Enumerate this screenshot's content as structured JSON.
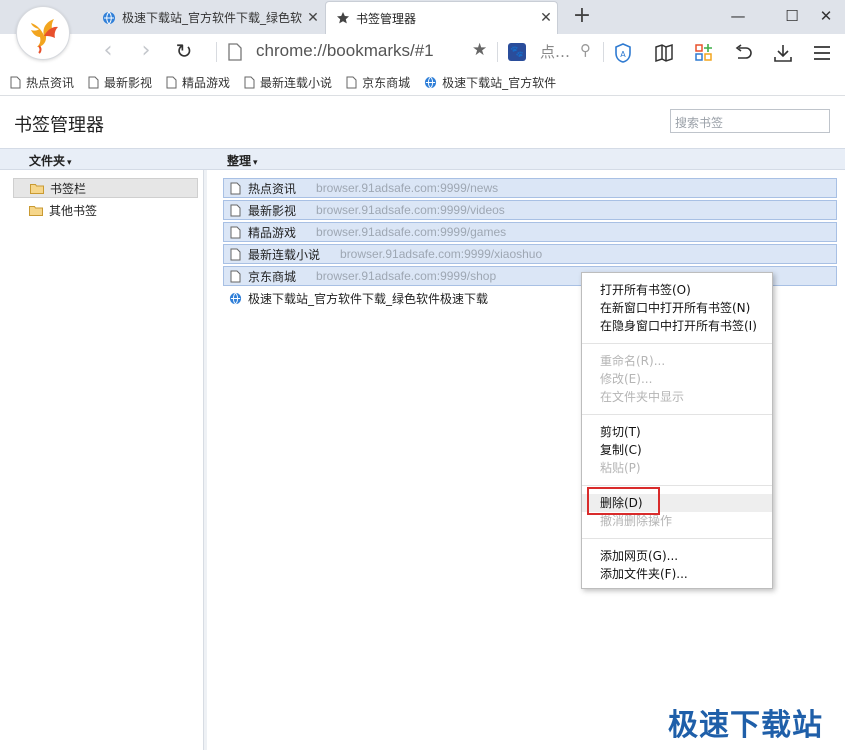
{
  "tabs": [
    {
      "label": "极速下载站_官方软件下载_绿色软件",
      "close": "✕"
    },
    {
      "label": "书签管理器",
      "close": "✕"
    }
  ],
  "newtab": "+",
  "window": {
    "minimize": "—",
    "maximize": "☐",
    "close": "✕"
  },
  "nav": {
    "back": "‹",
    "forward": "›",
    "reload": "↻",
    "address": "chrome://bookmarks/#1",
    "star": "★",
    "search_engine_glyph": "🐾",
    "search_placeholder": "点…",
    "search_icon": "⚲"
  },
  "bookmarks_bar": [
    {
      "label": "热点资讯",
      "icon": "doc"
    },
    {
      "label": "最新影视",
      "icon": "doc"
    },
    {
      "label": "精品游戏",
      "icon": "doc"
    },
    {
      "label": "最新连载小说",
      "icon": "doc"
    },
    {
      "label": "京东商城",
      "icon": "doc"
    },
    {
      "label": "极速下载站_官方软件",
      "icon": "globe"
    }
  ],
  "page": {
    "title": "书签管理器",
    "search_placeholder": "搜索书签"
  },
  "headers": {
    "folders": "文件夹",
    "organize": "整理",
    "caret": "▾"
  },
  "folders": [
    {
      "label": "书签栏",
      "selected": true
    },
    {
      "label": "其他书签",
      "selected": false
    }
  ],
  "bookmarks": [
    {
      "title": "热点资讯",
      "url": "browser.91adsafe.com:9999/news"
    },
    {
      "title": "最新影视",
      "url": "browser.91adsafe.com:9999/videos"
    },
    {
      "title": "精品游戏",
      "url": "browser.91adsafe.com:9999/games"
    },
    {
      "title": "最新连载小说",
      "url": "browser.91adsafe.com:9999/xiaoshuo"
    },
    {
      "title": "京东商城",
      "url": "browser.91adsafe.com:9999/shop"
    }
  ],
  "site_bookmark": {
    "title": "极速下载站_官方软件下载_绿色软件极速下载"
  },
  "context_menu": [
    {
      "label": "打开所有书签(O)",
      "enabled": true
    },
    {
      "label": "在新窗口中打开所有书签(N)",
      "enabled": true
    },
    {
      "label": "在隐身窗口中打开所有书签(I)",
      "enabled": true
    },
    {
      "label": "重命名(R)...",
      "enabled": false
    },
    {
      "label": "修改(E)...",
      "enabled": false
    },
    {
      "label": "在文件夹中显示",
      "enabled": false
    },
    {
      "label": "剪切(T)",
      "enabled": true
    },
    {
      "label": "复制(C)",
      "enabled": true
    },
    {
      "label": "粘贴(P)",
      "enabled": false
    },
    {
      "label": "删除(D)",
      "enabled": true,
      "highlighted": true
    },
    {
      "label": "撤消删除操作",
      "enabled": false
    },
    {
      "label": "添加网页(G)...",
      "enabled": true
    },
    {
      "label": "添加文件夹(F)...",
      "enabled": true
    }
  ],
  "watermark": "极速下载站",
  "colors": {
    "accent": "#1f5fa9",
    "selection": "#dbe6f6",
    "highlight_box": "#d92b2b"
  }
}
